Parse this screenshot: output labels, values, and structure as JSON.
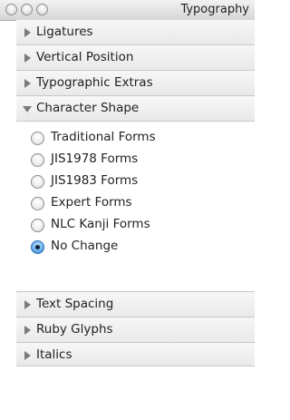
{
  "window": {
    "title": "Typography"
  },
  "sections_top": [
    {
      "label": "Ligatures"
    },
    {
      "label": "Vertical Position"
    },
    {
      "label": "Typographic Extras"
    },
    {
      "label": "Character Shape"
    }
  ],
  "character_shape": {
    "options": [
      {
        "label": "Traditional Forms",
        "selected": false
      },
      {
        "label": "JIS1978 Forms",
        "selected": false
      },
      {
        "label": "JIS1983 Forms",
        "selected": false
      },
      {
        "label": "Expert Forms",
        "selected": false
      },
      {
        "label": "NLC Kanji Forms",
        "selected": false
      },
      {
        "label": "No Change",
        "selected": true
      }
    ]
  },
  "sections_bottom": [
    {
      "label": "Text Spacing"
    },
    {
      "label": "Ruby Glyphs"
    },
    {
      "label": "Italics"
    }
  ]
}
